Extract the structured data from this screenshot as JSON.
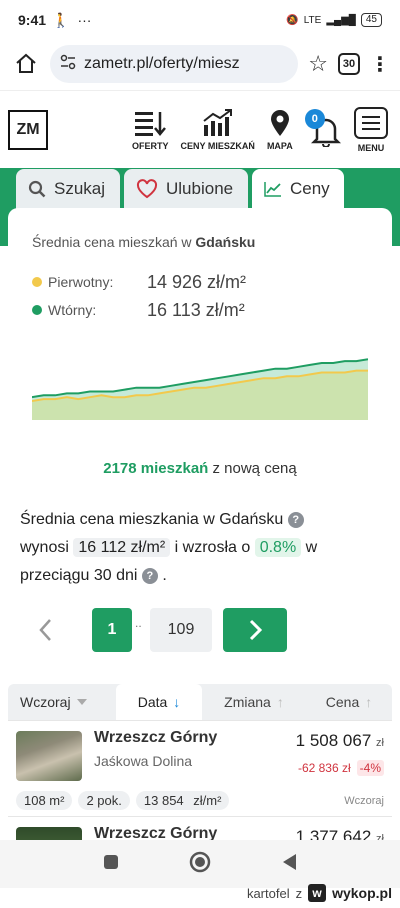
{
  "status": {
    "time": "9:41",
    "lte": "LTE",
    "battery": "45"
  },
  "browser": {
    "url": "zametr.pl/oferty/miesz",
    "tab_count": "30",
    "menu_glyph": "⋮"
  },
  "site": {
    "logo": "ZM",
    "nav": [
      {
        "label": "OFERTY",
        "icon": "list-sort-icon"
      },
      {
        "label": "CENY MIESZKAŃ",
        "icon": "bar-chart-icon"
      },
      {
        "label": "MAPA",
        "icon": "map-pin-icon"
      }
    ],
    "notifications": "0",
    "menu_label": "MENU"
  },
  "tabs": [
    {
      "label": "Szukaj",
      "icon": "search-icon"
    },
    {
      "label": "Ulubione",
      "icon": "heart-icon"
    },
    {
      "label": "Ceny",
      "icon": "line-chart-icon"
    }
  ],
  "stats": {
    "title_prefix": "Średnia cena mieszkań w",
    "city": "Gdańsku",
    "primary_label": "Pierwotny:",
    "primary_value": "14 926 zł/m²",
    "primary_color": "#f2c94c",
    "secondary_label": "Wtórny:",
    "secondary_value": "16 113 zł/m²",
    "secondary_color": "#1f9d62"
  },
  "chart_data": {
    "type": "area",
    "series": [
      {
        "name": "Pierwotny",
        "values": [
          10,
          11,
          11,
          12,
          11,
          12,
          13,
          12,
          12,
          13,
          13,
          14,
          15,
          16,
          17,
          17,
          18,
          19,
          20,
          21,
          22,
          22,
          23,
          23,
          24,
          25,
          25,
          25,
          26,
          26
        ]
      },
      {
        "name": "Wtórny",
        "values": [
          12,
          13,
          13,
          14,
          14,
          15,
          15,
          15,
          16,
          17,
          17,
          17,
          18,
          19,
          20,
          21,
          22,
          23,
          24,
          25,
          26,
          27,
          27,
          28,
          29,
          30,
          30,
          31,
          31,
          32
        ]
      }
    ],
    "ylim": [
      0,
      40
    ]
  },
  "new_price": {
    "count": "2178 mieszkań",
    "suffix": "z nową ceną"
  },
  "summary": {
    "line1": "Średnia cena mieszkania w Gdańsku",
    "wynosi": "wynosi",
    "value": "16 112 zł/m²",
    "rose": "i wzrosła o",
    "pct": "0.8%",
    "w": "w",
    "period": "przeciągu 30 dni",
    "dot": "."
  },
  "pager": {
    "current": "1",
    "separator": "..",
    "last": "109"
  },
  "sort": {
    "selected": "Wczoraj",
    "columns": [
      {
        "label": "Data",
        "arrow": "↓"
      },
      {
        "label": "Zmiana",
        "arrow": "↑"
      },
      {
        "label": "Cena",
        "arrow": "↑"
      }
    ]
  },
  "listings": [
    {
      "name": "Wrzeszcz Górny",
      "street": "Jaśkowa Dolina",
      "price": "1 508 067",
      "currency": "zł",
      "change": "-62 836 zł",
      "change_pct": "-4%",
      "area": "108 m²",
      "rooms": "2 pok.",
      "ppm": "13 854",
      "ppm_unit": "zł/m²",
      "date": "Wczoraj"
    },
    {
      "name": "Wrzeszcz Górny",
      "price": "1 377 642",
      "currency": "zł"
    }
  ],
  "footer": {
    "user": "kartofel",
    "z": "z",
    "brand": "wykop.pl"
  }
}
